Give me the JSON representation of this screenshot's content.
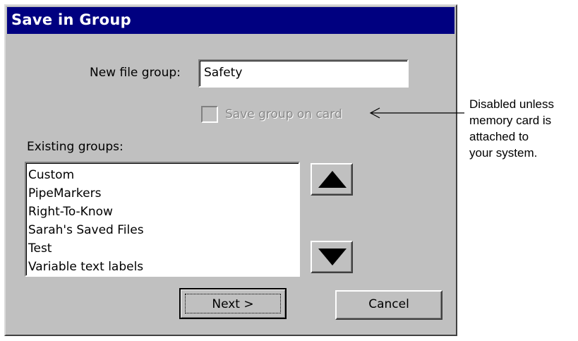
{
  "dialog": {
    "title": "Save in Group",
    "new_group_label": "New file group:",
    "new_group_value": "Safety",
    "save_on_card_label": "Save group on card",
    "save_on_card_checked": false,
    "save_on_card_disabled": true,
    "existing_groups_label": "Existing groups:",
    "existing_groups": [
      "Custom",
      "PipeMarkers",
      "Right-To-Know",
      "Sarah's Saved Files",
      "Test",
      "Variable text labels"
    ],
    "scroll_up_icon": "triangle-up-icon",
    "scroll_down_icon": "triangle-down-icon",
    "next_label": "Next >",
    "cancel_label": "Cancel"
  },
  "annotation": {
    "line1": "Disabled unless",
    "line2": "memory card is",
    "line3": "attached to",
    "line4": "your system."
  },
  "colors": {
    "title_bar": "#000080",
    "dialog_face": "#c0c0c0",
    "disabled_text": "#888888"
  }
}
